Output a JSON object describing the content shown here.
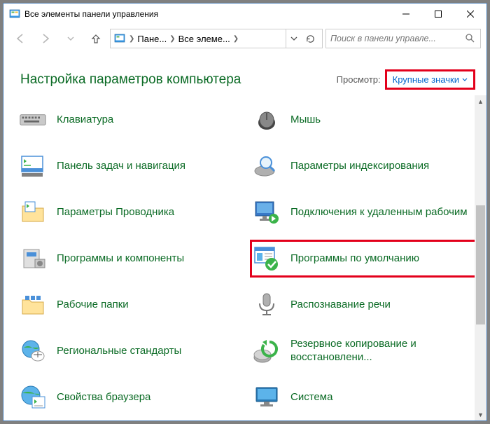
{
  "title": "Все элементы панели управления",
  "breadcrumb": {
    "level1": "Пане...",
    "level2": "Все элеме..."
  },
  "search": {
    "placeholder": "Поиск в панели управле..."
  },
  "heading": "Настройка параметров компьютера",
  "view": {
    "label": "Просмотр:",
    "value": "Крупные значки"
  },
  "items": [
    {
      "label": "Клавиатура",
      "icon": "keyboard-icon"
    },
    {
      "label": "Мышь",
      "icon": "mouse-icon"
    },
    {
      "label": "Панель задач и навигация",
      "icon": "taskbar-icon"
    },
    {
      "label": "Параметры индексирования",
      "icon": "indexing-icon"
    },
    {
      "label": "Параметры Проводника",
      "icon": "folder-options-icon"
    },
    {
      "label": "Подключения к удаленным рабочим",
      "icon": "remote-icon"
    },
    {
      "label": "Программы и компоненты",
      "icon": "programs-icon"
    },
    {
      "label": "Программы по умолчанию",
      "icon": "default-programs-icon"
    },
    {
      "label": "Рабочие папки",
      "icon": "work-folders-icon"
    },
    {
      "label": "Распознавание речи",
      "icon": "speech-icon"
    },
    {
      "label": "Региональные стандарты",
      "icon": "region-icon"
    },
    {
      "label": "Резервное копирование и восстановлени...",
      "icon": "backup-icon"
    },
    {
      "label": "Свойства браузера",
      "icon": "internet-options-icon"
    },
    {
      "label": "Система",
      "icon": "system-icon"
    }
  ]
}
